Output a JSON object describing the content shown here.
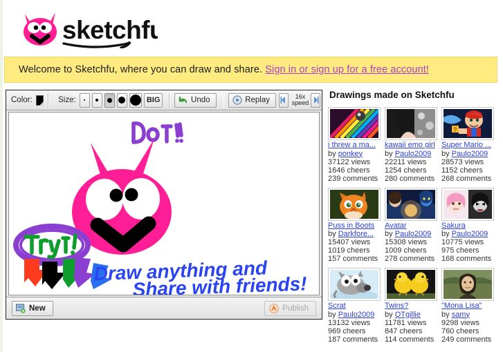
{
  "site": {
    "logo_text": "sketchfu",
    "logo_pink": "#ff1e96"
  },
  "banner": {
    "message": "Welcome to Sketchfu, where you can draw and share.",
    "link_text": "Sign in or sign up for a free account!",
    "bg_color": "#ffeb7f",
    "link_color": "#b03cc9"
  },
  "editor": {
    "toolbar": {
      "color_label": "Color:",
      "color_value": "#000000",
      "size_label": "Size:",
      "sizes": [
        {
          "name": "tiny",
          "px": 2,
          "active": false
        },
        {
          "name": "small",
          "px": 4,
          "active": false
        },
        {
          "name": "medium",
          "px": 7,
          "active": true
        },
        {
          "name": "large",
          "px": 10,
          "active": false
        },
        {
          "name": "xlarge",
          "px": 16,
          "active": false
        }
      ],
      "big_label": "BIG",
      "undo_label": "Undo",
      "replay_label": "Replay",
      "speed_prev": "◀",
      "speed_next": "▶",
      "speed_value": "16x",
      "speed_unit": "speed"
    },
    "canvas": {
      "text_do_it": "Do it!!",
      "text_try_it": "Try it!",
      "text_line1": "Draw anything and",
      "text_line2": "Share with friends!",
      "colors": {
        "pink": "#ff1e96",
        "purple": "#8b3fd0",
        "green": "#0f9e2e",
        "blue": "#2a45f0",
        "black": "#000000",
        "red": "#ff3b1e"
      }
    },
    "footer": {
      "new_label": "New",
      "publish_label": "Publish"
    }
  },
  "gallery": {
    "title": "Drawings made on Sketchfu",
    "items": [
      {
        "title": "i threw a ma...",
        "by_label": "by",
        "author": "ponkey",
        "views": "37122 views",
        "cheers": "1646 cheers",
        "comments": "239 comments",
        "thumb": "colored-pencils"
      },
      {
        "title": "kawaii emo girl",
        "by_label": "by",
        "author": "Paulo2009",
        "views": "22211 views",
        "cheers": "1254 cheers",
        "comments": "280 comments",
        "thumb": "emo-girl"
      },
      {
        "title": "Super Mario ...",
        "by_label": "by",
        "author": "Paulo2009",
        "views": "28573 views",
        "cheers": "1152 cheers",
        "comments": "268 comments",
        "thumb": "super-mario"
      },
      {
        "title": "Puss in Boots",
        "by_label": "by",
        "author": "Darkfore...",
        "views": "15407 views",
        "cheers": "1019 cheers",
        "comments": "157 comments",
        "thumb": "puss-in-boots"
      },
      {
        "title": "Avatar",
        "by_label": "by",
        "author": "Paulo2009",
        "views": "15308 views",
        "cheers": "1009 cheers",
        "comments": "278 comments",
        "thumb": "avatar"
      },
      {
        "title": "Sakura",
        "by_label": "by",
        "author": "Paulo2009",
        "views": "10775 views",
        "cheers": "975 cheers",
        "comments": "168 comments",
        "thumb": "sakura"
      },
      {
        "title": "Scrat",
        "by_label": "by",
        "author": "Paulo2009",
        "views": "13132 views",
        "cheers": "969 cheers",
        "comments": "187 comments",
        "thumb": "scrat"
      },
      {
        "title": "Twins?",
        "by_label": "by",
        "author": "QTgillie",
        "views": "11781 views",
        "cheers": "847 cheers",
        "comments": "114 comments",
        "thumb": "twins-chicks"
      },
      {
        "title": "\"Mona Lisa\"",
        "by_label": "by",
        "author": "samy",
        "views": "9298 views",
        "cheers": "760 cheers",
        "comments": "249 comments",
        "thumb": "mona-lisa"
      }
    ]
  }
}
